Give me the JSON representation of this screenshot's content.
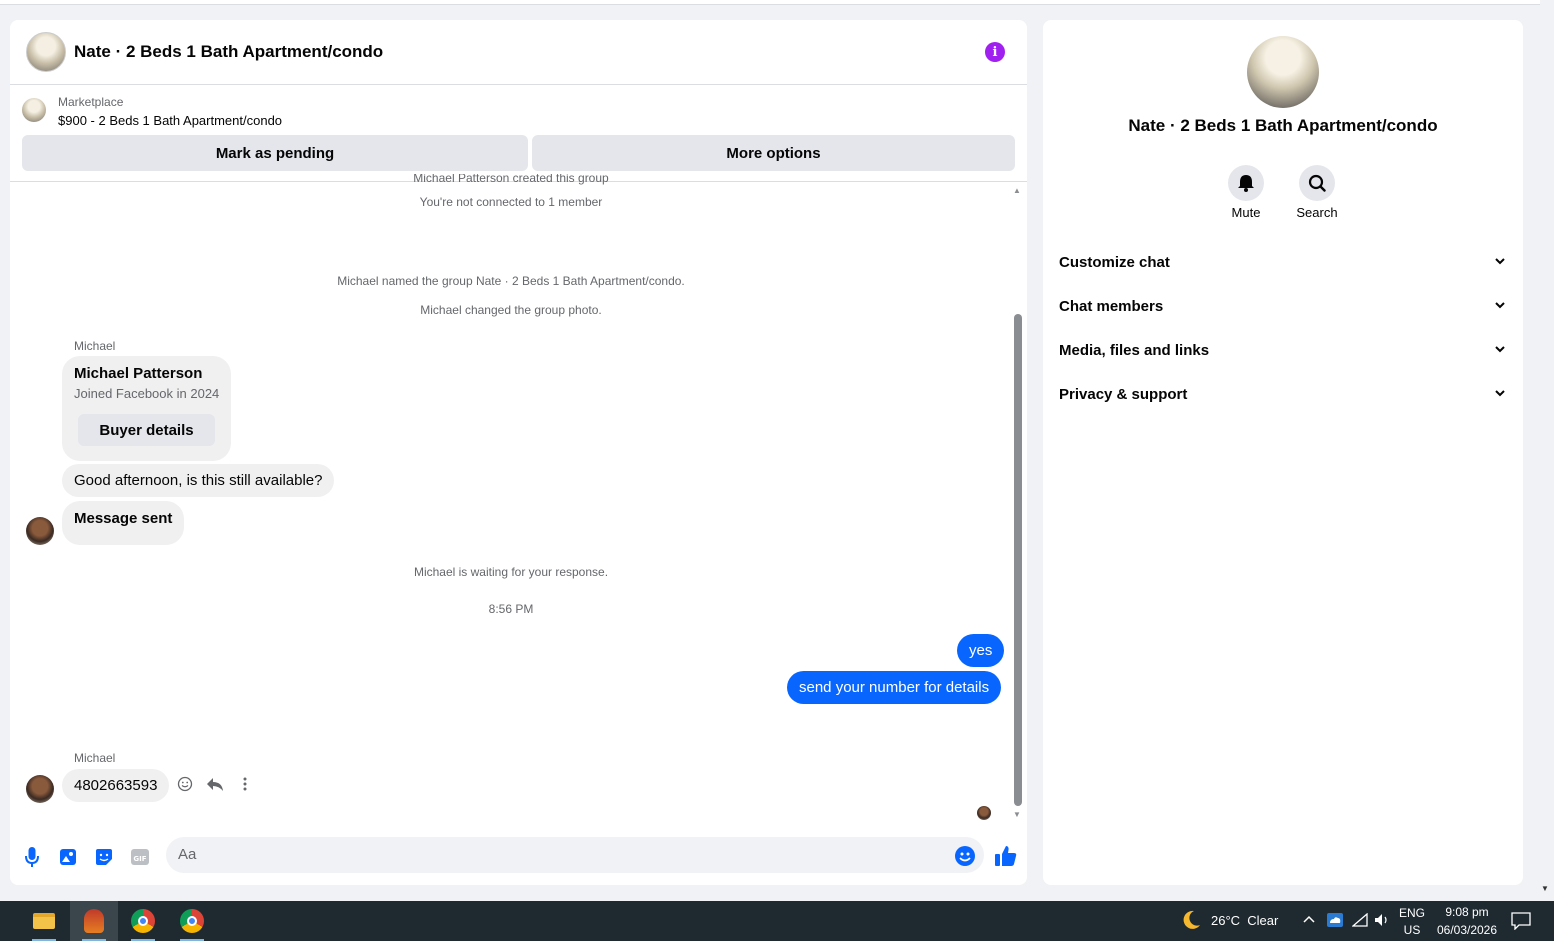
{
  "chat": {
    "title": "Nate · 2 Beds 1 Bath Apartment/condo",
    "marketplace_label": "Marketplace",
    "listing": "$900 - 2 Beds 1 Bath Apartment/condo",
    "mark_pending": "Mark as pending",
    "more_options": "More options",
    "system_top1": "Michael Patterson created this group",
    "system_top2": "You're not connected to 1 member",
    "system_named": "Michael named the group Nate · 2 Beds 1 Bath Apartment/condo.",
    "system_photo": "Michael changed the group photo.",
    "sender": "Michael",
    "card_name": "Michael Patterson",
    "card_sub": "Joined Facebook in 2024",
    "card_button": "Buyer details",
    "msg1": "Good afternoon, is this still available?",
    "msg2": "Message sent",
    "waiting": "Michael is waiting for your response.",
    "time": "8:56 PM",
    "out1": "yes",
    "out2": "send your number for details",
    "sender2": "Michael",
    "msg3": "4802663593",
    "input_placeholder": "Aa",
    "icons": [
      "mic-icon",
      "photo-icon",
      "sticker-icon",
      "gif-icon",
      "emoji-icon",
      "like-icon"
    ],
    "accent": "#0866ff"
  },
  "side": {
    "title": "Nate · 2 Beds 1 Bath Apartment/condo",
    "mute": "Mute",
    "search": "Search",
    "sections": [
      "Customize chat",
      "Chat members",
      "Media, files and links",
      "Privacy & support"
    ]
  },
  "taskbar": {
    "weather": "26°C  Clear",
    "lang1": "ENG",
    "lang2": "US",
    "clock_time": "9:08 pm",
    "clock_date": "06/03/2026"
  }
}
